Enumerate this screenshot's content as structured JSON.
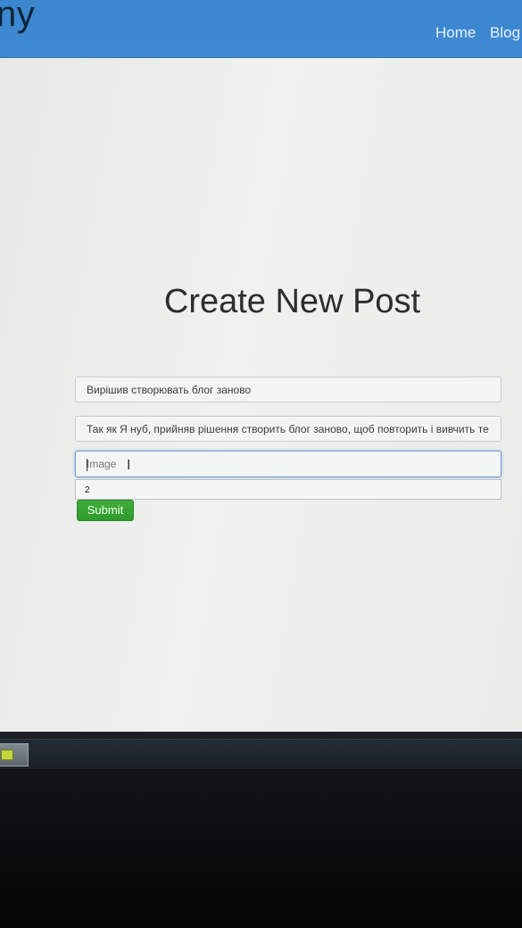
{
  "navbar": {
    "brand": "ny",
    "links": [
      "Home",
      "Blog"
    ]
  },
  "page": {
    "title": "Create New Post"
  },
  "form": {
    "title_value": "Вирішив створювать блог заново",
    "body_value": "Так як Я нуб, прийняв рішення створить блог заново, щоб повторить і вивчить те",
    "image_placeholder": "Image",
    "image_value": "",
    "autocomplete_options": [
      "2"
    ],
    "submit_label": "Submit"
  },
  "icons": {
    "cursor": "i-beam-cursor-icon",
    "taskbar_app": "app-icon"
  },
  "colors": {
    "navbar": "#3a86cf",
    "submit": "#2f9a2c",
    "focus_border": "#6b9bd8"
  }
}
